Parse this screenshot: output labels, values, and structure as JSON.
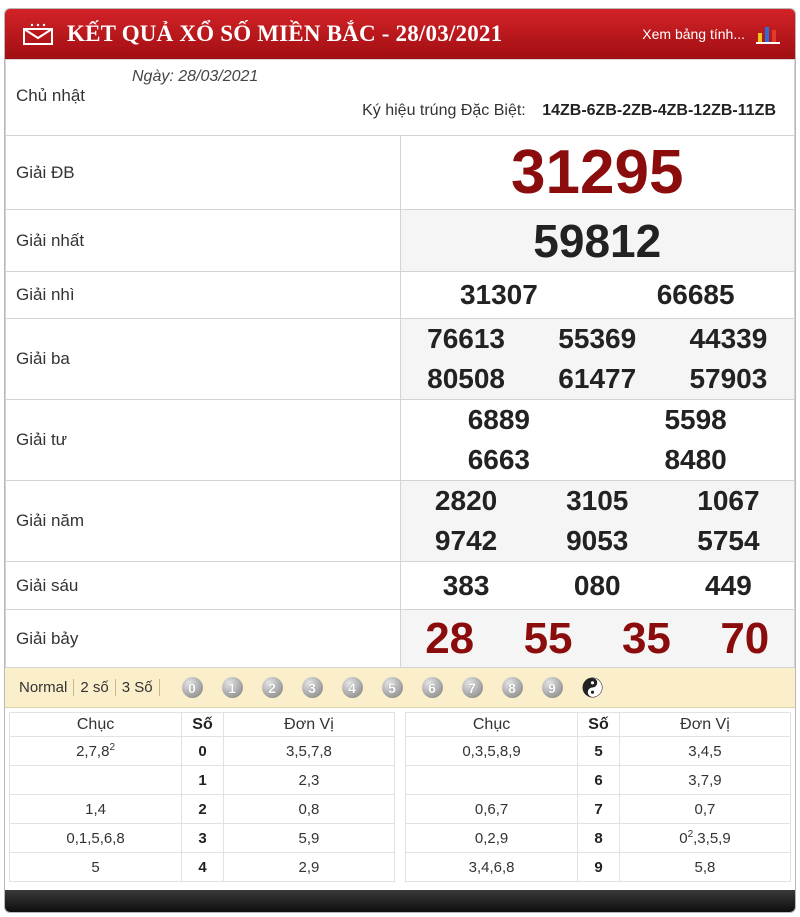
{
  "header": {
    "title": "KẾT QUẢ XỔ SỐ MIỀN BẮC - 28/03/2021",
    "link": "Xem bảng tính..."
  },
  "info": {
    "day": "Chủ nhật",
    "date": "Ngày: 28/03/2021",
    "symbol_label": "Ký hiệu trúng Đặc Biệt:",
    "symbol_codes": "14ZB-6ZB-2ZB-4ZB-12ZB-11ZB"
  },
  "prizes": {
    "db": {
      "label": "Giải ĐB",
      "numbers": [
        "31295"
      ]
    },
    "nhat": {
      "label": "Giải nhất",
      "numbers": [
        "59812"
      ]
    },
    "nhi": {
      "label": "Giải nhì",
      "numbers": [
        "31307",
        "66685"
      ]
    },
    "ba": {
      "label": "Giải ba",
      "numbers": [
        "76613",
        "55369",
        "44339",
        "80508",
        "61477",
        "57903"
      ]
    },
    "tu": {
      "label": "Giải tư",
      "numbers": [
        "6889",
        "5598",
        "6663",
        "8480"
      ]
    },
    "nam": {
      "label": "Giải năm",
      "numbers": [
        "2820",
        "3105",
        "1067",
        "9742",
        "9053",
        "5754"
      ]
    },
    "sau": {
      "label": "Giải sáu",
      "numbers": [
        "383",
        "080",
        "449"
      ]
    },
    "bay": {
      "label": "Giải bảy",
      "numbers": [
        "28",
        "55",
        "35",
        "70"
      ]
    }
  },
  "filters": [
    "Normal",
    "2 số",
    "3 Số"
  ],
  "digits": [
    "0",
    "1",
    "2",
    "3",
    "4",
    "5",
    "6",
    "7",
    "8",
    "9"
  ],
  "loto": {
    "headers": {
      "chuc": "Chục",
      "so": "Số",
      "dv": "Đơn Vị"
    },
    "left": [
      {
        "chuc": "2,7,8",
        "chuc_sup": "2",
        "so": "0",
        "dv": "3,5,7,8",
        "dv_sup": ""
      },
      {
        "chuc": "",
        "chuc_sup": "",
        "so": "1",
        "dv": "2,3",
        "dv_sup": ""
      },
      {
        "chuc": "1,4",
        "chuc_sup": "",
        "so": "2",
        "dv": "0,8",
        "dv_sup": ""
      },
      {
        "chuc": "0,1,5,6,8",
        "chuc_sup": "",
        "so": "3",
        "dv": "5,9",
        "dv_sup": ""
      },
      {
        "chuc": "5",
        "chuc_sup": "",
        "so": "4",
        "dv": "2,9",
        "dv_sup": ""
      }
    ],
    "right": [
      {
        "chuc": "0,3,5,8,9",
        "chuc_sup": "",
        "so": "5",
        "dv": "3,4,5",
        "dv_sup": ""
      },
      {
        "chuc": "",
        "chuc_sup": "",
        "so": "6",
        "dv": "3,7,9",
        "dv_sup": ""
      },
      {
        "chuc": "0,6,7",
        "chuc_sup": "",
        "so": "7",
        "dv": "0,7",
        "dv_sup": ""
      },
      {
        "chuc": "0,2,9",
        "chuc_sup": "",
        "so": "8",
        "dv_pre": "0",
        "dv_pre_sup": "2",
        "dv": ",3,5,9",
        "dv_sup": ""
      },
      {
        "chuc": "3,4,6,8",
        "chuc_sup": "",
        "so": "9",
        "dv": "5,8",
        "dv_sup": ""
      }
    ]
  }
}
